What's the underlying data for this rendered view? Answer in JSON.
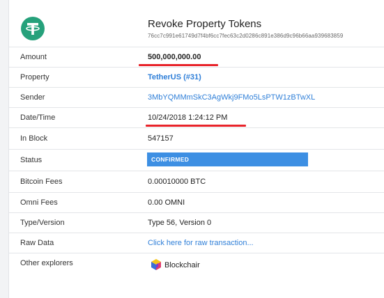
{
  "header": {
    "title": "Revoke Property Tokens",
    "txid": "76cc7c991e61749d7f4bf6cc7fec63c2d0286c891e386d9c96b66aa939683859",
    "logo_icon": "tether-logo-icon"
  },
  "fields": {
    "amount": {
      "label": "Amount",
      "value": "500,000,000.00"
    },
    "property": {
      "label": "Property",
      "value": "TetherUS (#31)"
    },
    "sender": {
      "label": "Sender",
      "value": "3MbYQMMmSkC3AgWkj9FMo5LsPTW1zBTwXL"
    },
    "datetime": {
      "label": "Date/Time",
      "value": "10/24/2018 1:24:12 PM"
    },
    "block": {
      "label": "In Block",
      "value": "547157"
    },
    "status": {
      "label": "Status",
      "value": "CONFIRMED"
    },
    "btc_fees": {
      "label": "Bitcoin Fees",
      "value": "0.00010000 BTC"
    },
    "omni_fees": {
      "label": "Omni Fees",
      "value": "0.00 OMNI"
    },
    "type": {
      "label": "Type/Version",
      "value": "Type 56, Version 0"
    },
    "raw": {
      "label": "Raw Data",
      "value": "Click here for raw transaction..."
    },
    "explorers": {
      "label": "Other explorers",
      "value": "Blockchair",
      "icon": "blockchair-icon"
    }
  },
  "colors": {
    "link": "#2f7fd8",
    "status_badge": "#3d8fe3",
    "annotation_underline": "#e8232a",
    "tether_green": "#26a17b"
  }
}
